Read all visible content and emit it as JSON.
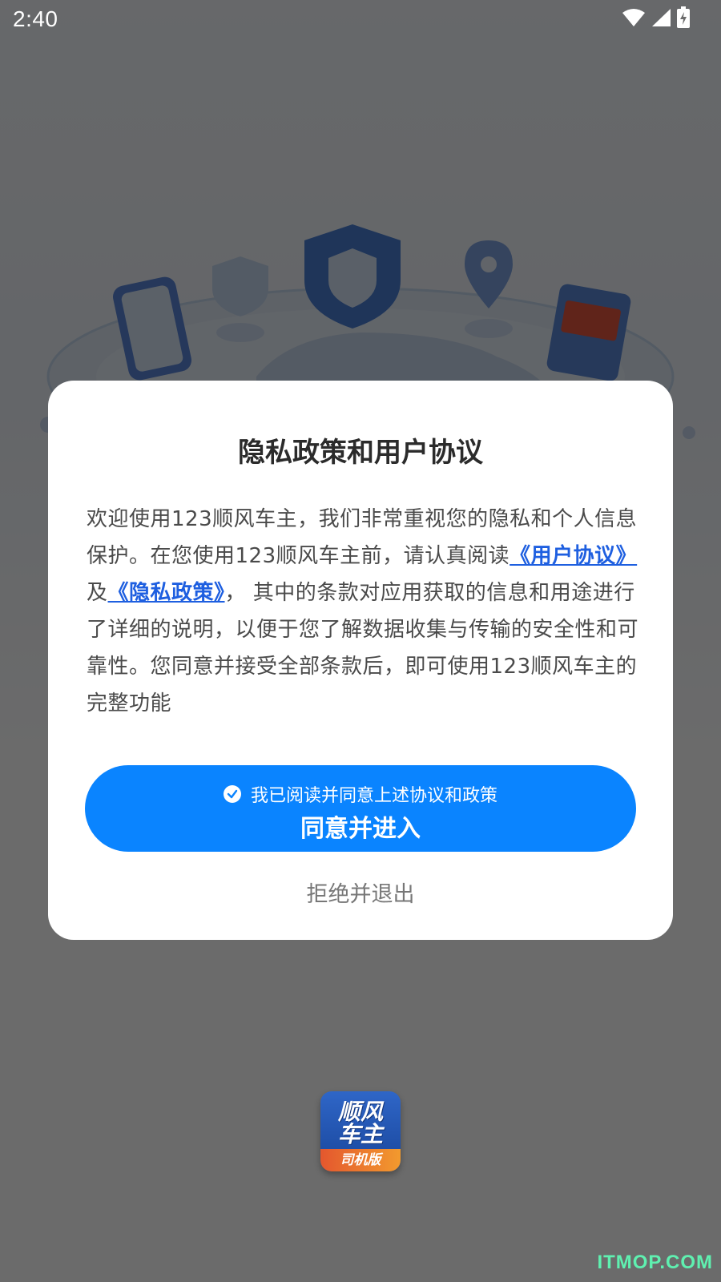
{
  "status_bar": {
    "time": "2:40"
  },
  "dialog": {
    "title": "隐私政策和用户协议",
    "body_intro": "欢迎使用123顺风车主，我们非常重视您的隐私和个人信息保护。在您使用123顺风车主前，请认真阅读",
    "user_agreement_link": "《用户协议》",
    "conjunction": "及",
    "privacy_policy_link": "《隐私政策》",
    "body_rest": "， 其中的条款对应用获取的信息和用途进行了详细的说明，以便于您了解数据收集与传输的安全性和可靠性。您同意并接受全部条款后，即可使用123顺风车主的完整功能",
    "agree_checkbox_label": "我已阅读并同意上述协议和政策",
    "agree_checked": true,
    "agree_button_label": "同意并进入",
    "reject_button_label": "拒绝并退出"
  },
  "app_logo": {
    "line1": "顺风",
    "line2": "车主",
    "strip": "司机版"
  },
  "watermark": "ITMOP.COM",
  "colors": {
    "primary": "#0a84ff",
    "link": "#1e5fe0",
    "overlay": "rgba(0,0,0,0.58)"
  },
  "icons": {
    "wifi": "wifi-icon",
    "signal": "signal-icon",
    "battery": "battery-charging-icon",
    "check": "check-circle-icon"
  }
}
